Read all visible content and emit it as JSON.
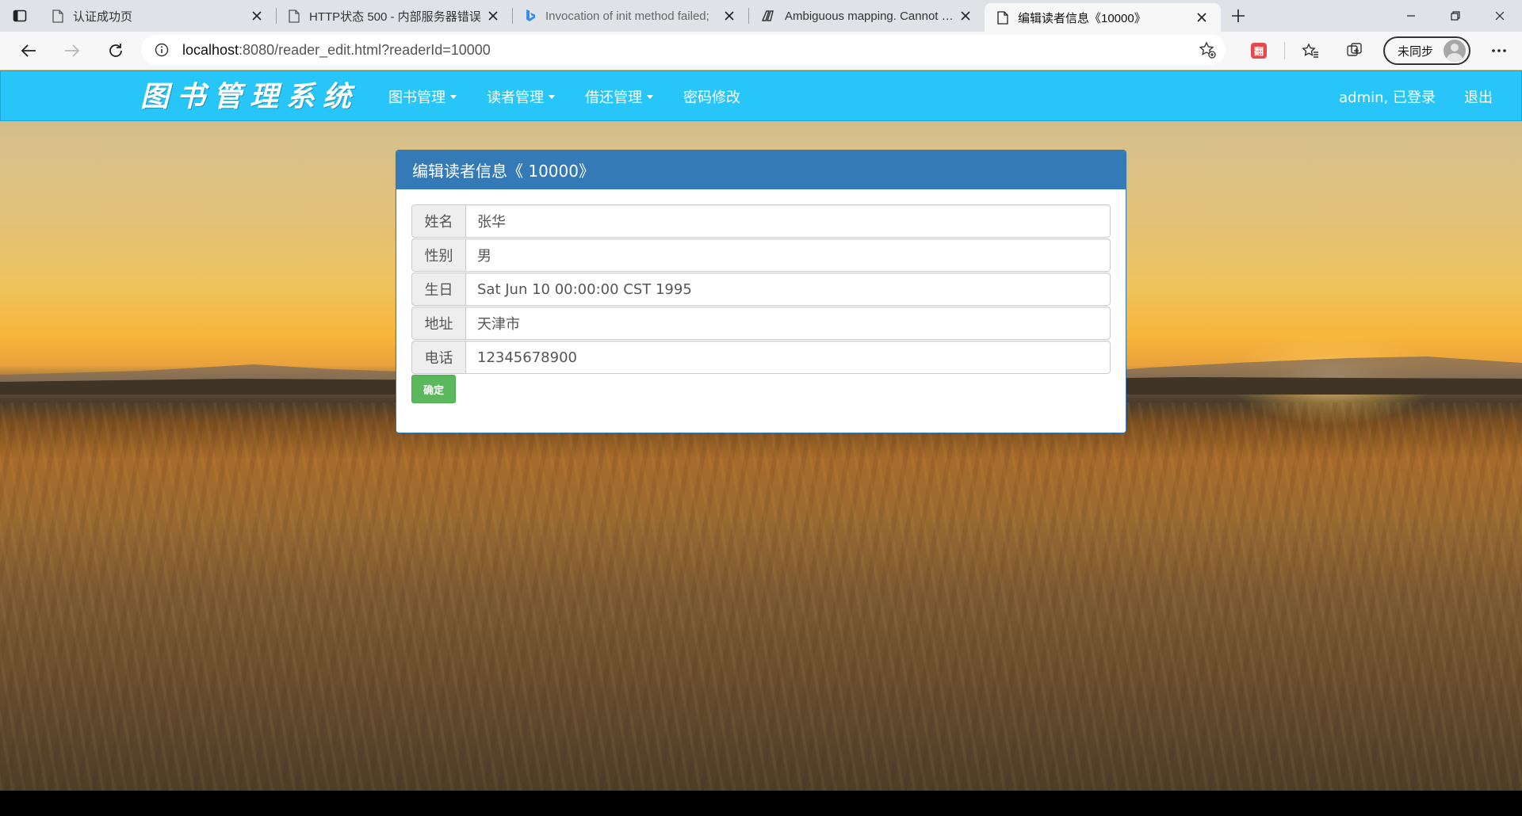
{
  "browser": {
    "tabs": [
      {
        "title": "认证成功页",
        "active": false,
        "icon": "page-icon"
      },
      {
        "title": "HTTP状态 500 - 内部服务器错误",
        "active": false,
        "icon": "page-icon"
      },
      {
        "title": "Invocation of init method failed;",
        "active": false,
        "icon": "bing-icon"
      },
      {
        "title": "Ambiguous mapping. Cannot map",
        "active": false,
        "icon": "copilot-icon"
      },
      {
        "title": "编辑读者信息《10000》",
        "active": true,
        "icon": "page-icon"
      }
    ],
    "address": {
      "host": "localhost",
      "path": ":8080/reader_edit.html?readerId=10000"
    },
    "sync_label": "未同步",
    "extension_badge": "翻"
  },
  "navbar": {
    "brand": "图书管理系统",
    "menu": [
      {
        "label": "图书管理",
        "dropdown": true
      },
      {
        "label": "读者管理",
        "dropdown": true
      },
      {
        "label": "借还管理",
        "dropdown": true
      },
      {
        "label": "密码修改",
        "dropdown": false
      }
    ],
    "user_label": "admin, 已登录",
    "logout_label": "退出",
    "color": "#27c5f8"
  },
  "panel": {
    "title": "编辑读者信息《 10000》",
    "fields": [
      {
        "label": "姓名",
        "value": "张华"
      },
      {
        "label": "性别",
        "value": "男"
      },
      {
        "label": "生日",
        "value": "Sat Jun 10 00:00:00 CST 1995"
      },
      {
        "label": "地址",
        "value": "天津市"
      },
      {
        "label": "电话",
        "value": "12345678900"
      }
    ],
    "submit_label": "确定",
    "heading_color": "#337ab7",
    "button_color": "#5cb85c"
  }
}
